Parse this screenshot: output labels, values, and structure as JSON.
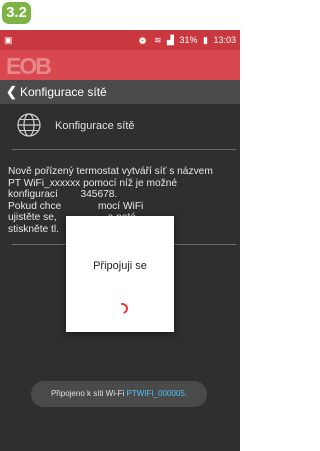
{
  "step_label": "3.2",
  "status_bar": {
    "left_icon": "image-icon",
    "icons": [
      "alarm-icon",
      "wifi-icon",
      "signal-icon"
    ],
    "battery": "31%",
    "time": "13:03"
  },
  "app": {
    "logo_text": "EOB"
  },
  "nav": {
    "back_icon": "chevron-left-icon",
    "title": "Konfigurace sítě"
  },
  "section": {
    "icon": "globe-icon",
    "label": "Konfigurace sítě"
  },
  "description": "Nově pořízený termostat vytváří síť s názvem\nPT WiFi_xxxxxx pomocí níž je možné\nkonfigurací        345678.\nPokud chce             mocí WiFi\nujistěte se,                  a poté\nstiskněte tl.",
  "dialog": {
    "title": "Připojuji se"
  },
  "toast": {
    "prefix": "Připojeno k síti Wi-Fi ",
    "ssid": "PTWIFI_000005",
    "suffix": "."
  },
  "colors": {
    "accent": "#d9474f",
    "spinner": "#e53935",
    "ssid": "#4fc3f7"
  }
}
